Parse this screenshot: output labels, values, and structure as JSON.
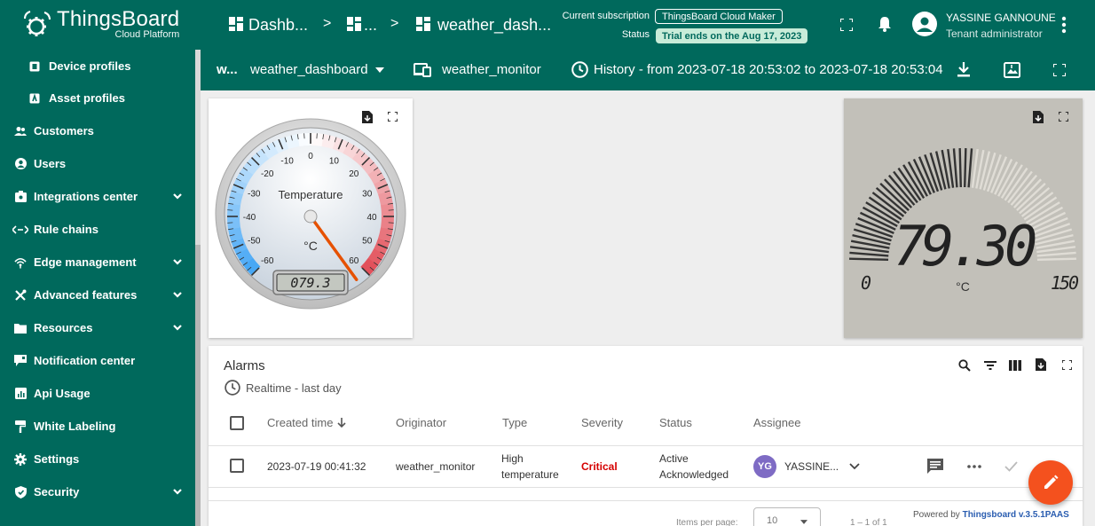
{
  "brand": {
    "name": "ThingsBoard",
    "sub": "Cloud Platform"
  },
  "sidebar": {
    "items": [
      {
        "label": "Device profiles",
        "icon": "device-profile-icon",
        "sub": true,
        "chev": false
      },
      {
        "label": "Asset profiles",
        "icon": "asset-profile-icon",
        "sub": true,
        "chev": false
      },
      {
        "label": "Customers",
        "icon": "customers-icon",
        "sub": false,
        "chev": false
      },
      {
        "label": "Users",
        "icon": "users-icon",
        "sub": false,
        "chev": false
      },
      {
        "label": "Integrations center",
        "icon": "integrations-icon",
        "sub": false,
        "chev": true
      },
      {
        "label": "Rule chains",
        "icon": "rule-chains-icon",
        "sub": false,
        "chev": false
      },
      {
        "label": "Edge management",
        "icon": "edge-icon",
        "sub": false,
        "chev": true
      },
      {
        "label": "Advanced features",
        "icon": "tools-icon",
        "sub": false,
        "chev": true
      },
      {
        "label": "Resources",
        "icon": "folder-icon",
        "sub": false,
        "chev": true
      },
      {
        "label": "Notification center",
        "icon": "notification-center-icon",
        "sub": false,
        "chev": false
      },
      {
        "label": "Api Usage",
        "icon": "chart-icon",
        "sub": false,
        "chev": false
      },
      {
        "label": "White Labeling",
        "icon": "paint-roller-icon",
        "sub": false,
        "chev": false
      },
      {
        "label": "Settings",
        "icon": "gear-icon",
        "sub": false,
        "chev": false
      },
      {
        "label": "Security",
        "icon": "shield-icon",
        "sub": false,
        "chev": true
      }
    ]
  },
  "topbar": {
    "breadcrumb_1": "Dashb...",
    "breadcrumb_2": "...",
    "breadcrumb_3": "weather_dash...",
    "sep": ">",
    "subscription_label": "Current subscription",
    "subscription_value": "ThingsBoard Cloud Maker",
    "status_label": "Status",
    "status_value": "Trial ends on the Aug 17, 2023",
    "user_name": "YASSINE GANNOUNE",
    "user_role": "Tenant administrator"
  },
  "toolbar": {
    "state_short": "w...",
    "dashboard": "weather_dashboard",
    "entity": "weather_monitor",
    "history": "History - from 2023-07-18 20:53:02 to 2023-07-18 20:53:04"
  },
  "gauge_left": {
    "title": "Temperature",
    "unit": "°C",
    "ticks": [
      "-60",
      "-50",
      "-40",
      "-30",
      "-20",
      "-10",
      "0",
      "10",
      "20",
      "30",
      "40",
      "50",
      "60"
    ],
    "lcd": "079.3",
    "value": 79.3
  },
  "gauge_right": {
    "value": "79.30",
    "unit": "°C",
    "min": "0",
    "max": "150",
    "fraction": 0.53
  },
  "alarms": {
    "title": "Alarms",
    "timewindow": "Realtime - last day",
    "headers": {
      "created": "Created time",
      "originator": "Originator",
      "type": "Type",
      "severity": "Severity",
      "status": "Status",
      "assignee": "Assignee"
    },
    "rows": [
      {
        "created": "2023-07-19 00:41:32",
        "originator": "weather_monitor",
        "type_1": "High",
        "type_2": "temperature",
        "severity": "Critical",
        "status_1": "Active",
        "status_2": "Acknowledged",
        "assignee_initials": "YG",
        "assignee": "YASSINE..."
      }
    ],
    "items_per_page_label": "Items per page:",
    "items_per_page": "10",
    "range": "1 – 1 of 1"
  },
  "footer": {
    "powered_by": "Powered by",
    "version_link": "Thingsboard v.3.5.1PAAS"
  },
  "colors": {
    "primary": "#00695c",
    "accent": "#f4511e",
    "critical": "#d50000"
  }
}
